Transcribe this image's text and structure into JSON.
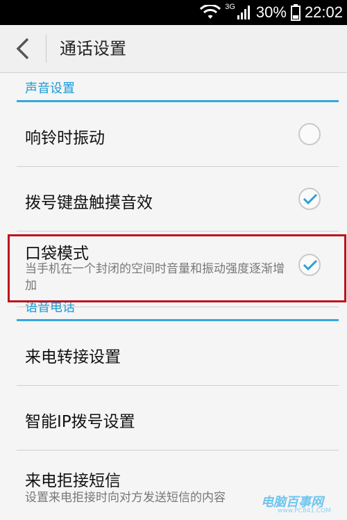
{
  "status_bar": {
    "network": "3G",
    "battery": "30%",
    "time": "22:02"
  },
  "action_bar": {
    "title": "通话设置"
  },
  "sections": [
    {
      "title": "声音设置"
    },
    {
      "title": "语音电话"
    }
  ],
  "items": [
    {
      "title": "响铃时振动",
      "checked": false
    },
    {
      "title": "拨号键盘触摸音效",
      "checked": true
    },
    {
      "title": "口袋模式",
      "summary": "当手机在一个封闭的空间时音量和振动强度逐渐增加",
      "checked": true
    },
    {
      "title": "来电转接设置"
    },
    {
      "title": "智能IP拨号设置"
    },
    {
      "title": "来电拒接短信",
      "summary": "设置来电拒接时向对方发送短信的内容"
    }
  ],
  "watermark": {
    "text": "电脑百事网",
    "url": "www.PC841.COM"
  },
  "colors": {
    "accent": "#1a9bd7",
    "highlight": "#c0121b"
  },
  "icons": {
    "back": "chevron-left-icon",
    "wifi": "wifi-icon",
    "signal": "signal-icon",
    "battery": "battery-icon",
    "check": "check-icon"
  }
}
